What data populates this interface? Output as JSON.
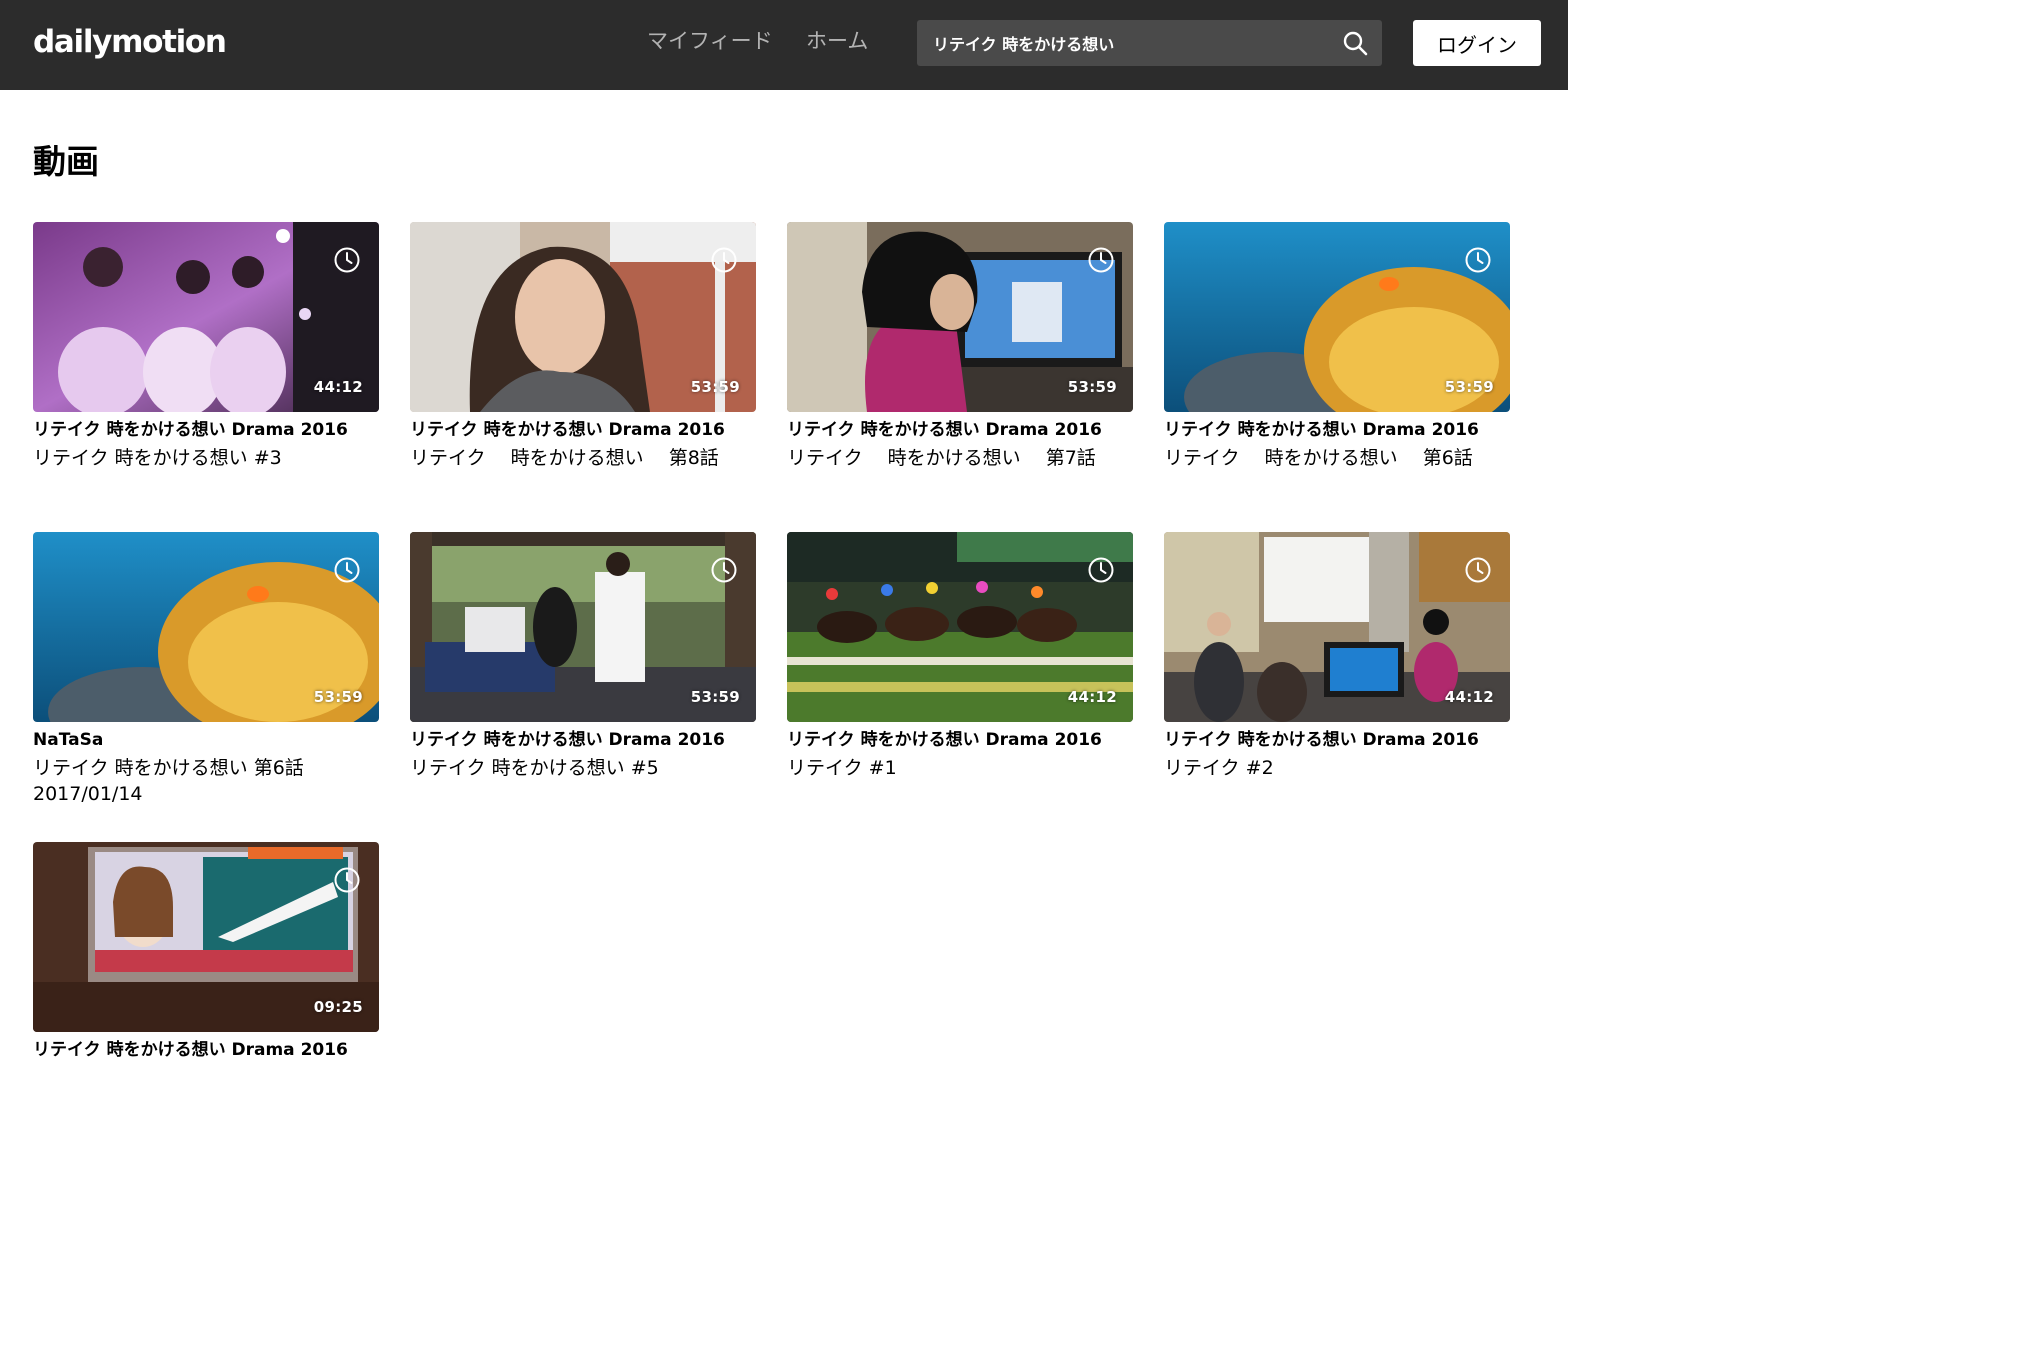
{
  "header": {
    "logo": "dailymotion",
    "nav": {
      "feed": "マイフィード",
      "home": "ホーム"
    },
    "search": {
      "value": "リテイク 時をかける想い"
    },
    "login_label": "ログイン"
  },
  "section": {
    "title": "動画"
  },
  "colors": {
    "header_bg": "#2c2c2c",
    "search_bg": "#4a4a4a",
    "text": "#000000"
  },
  "videos": [
    {
      "duration": "44:12",
      "channel": "リテイク 時をかける想い Drama 2016",
      "title": "リテイク 時をかける想い #3",
      "date": ""
    },
    {
      "duration": "53:59",
      "channel": "リテイク 時をかける想い Drama 2016",
      "title": "リテイク　 時をかける想い　 第8話",
      "date": ""
    },
    {
      "duration": "53:59",
      "channel": "リテイク 時をかける想い Drama 2016",
      "title": "リテイク　 時をかける想い　 第7話",
      "date": ""
    },
    {
      "duration": "53:59",
      "channel": "リテイク 時をかける想い Drama 2016",
      "title": "リテイク　 時をかける想い　 第6話",
      "date": ""
    },
    {
      "duration": "53:59",
      "channel": "NaTaSa",
      "title": "リテイク 時をかける想い 第6話",
      "date": "2017/01/14"
    },
    {
      "duration": "53:59",
      "channel": "リテイク 時をかける想い Drama 2016",
      "title": "リテイク 時をかける想い #5",
      "date": ""
    },
    {
      "duration": "44:12",
      "channel": "リテイク 時をかける想い Drama 2016",
      "title": "リテイク #1",
      "date": ""
    },
    {
      "duration": "44:12",
      "channel": "リテイク 時をかける想い Drama 2016",
      "title": "リテイク #2",
      "date": ""
    },
    {
      "duration": "09:25",
      "channel": "リテイク 時をかける想い Drama 2016",
      "title": "",
      "date": ""
    }
  ]
}
